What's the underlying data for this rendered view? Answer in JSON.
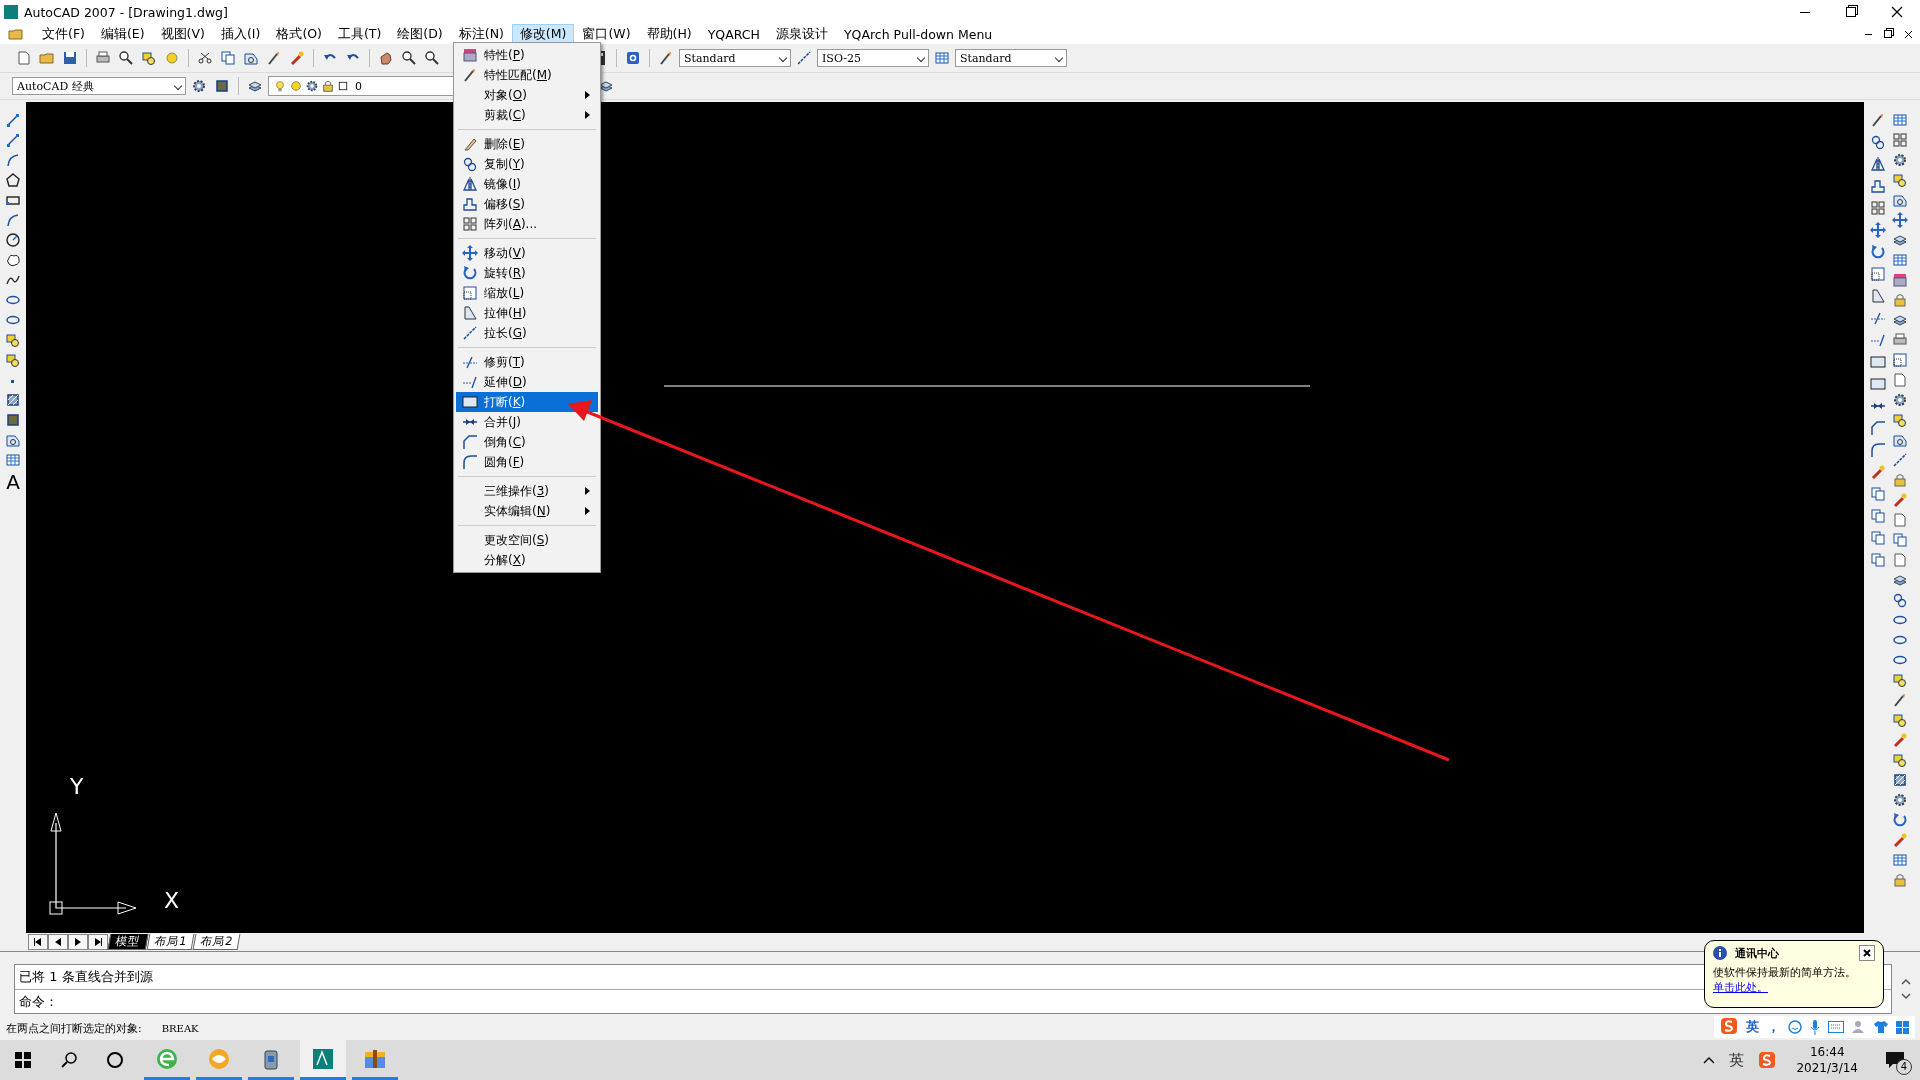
{
  "window": {
    "title": "AutoCAD 2007 - [Drawing1.dwg]"
  },
  "menu_bar": [
    {
      "label": "文件(F)",
      "selected": false
    },
    {
      "label": "编辑(E)",
      "selected": false
    },
    {
      "label": "视图(V)",
      "selected": false
    },
    {
      "label": "插入(I)",
      "selected": false
    },
    {
      "label": "格式(O)",
      "selected": false
    },
    {
      "label": "工具(T)",
      "selected": false
    },
    {
      "label": "绘图(D)",
      "selected": false
    },
    {
      "label": "标注(N)",
      "selected": false
    },
    {
      "label": "修改(M)",
      "selected": true
    },
    {
      "label": "窗口(W)",
      "selected": false
    },
    {
      "label": "帮助(H)",
      "selected": false
    },
    {
      "label": "YQARCH",
      "selected": false
    },
    {
      "label": "源泉设计",
      "selected": false
    },
    {
      "label": "YQArch Pull-down Menu",
      "selected": false
    }
  ],
  "toolbar": {
    "text_style": "Standard",
    "dim_style": "ISO-25",
    "table_style": "Standard",
    "workspace": "AutoCAD 经典",
    "layer": "0"
  },
  "draw_toolbar": {
    "text_tool": "A"
  },
  "modify_menu": {
    "groups": [
      [
        {
          "label": "特性(P)",
          "selected": false,
          "submenu": false
        },
        {
          "label": "特性匹配(M)",
          "selected": false,
          "submenu": false
        },
        {
          "label": "对象(O)",
          "selected": false,
          "submenu": true
        },
        {
          "label": "剪裁(C)",
          "selected": false,
          "submenu": true
        }
      ],
      [
        {
          "label": "删除(E)",
          "selected": false,
          "submenu": false
        },
        {
          "label": "复制(Y)",
          "selected": false,
          "submenu": false
        },
        {
          "label": "镜像(I)",
          "selected": false,
          "submenu": false
        },
        {
          "label": "偏移(S)",
          "selected": false,
          "submenu": false
        },
        {
          "label": "阵列(A)...",
          "selected": false,
          "submenu": false
        }
      ],
      [
        {
          "label": "移动(V)",
          "selected": false,
          "submenu": false
        },
        {
          "label": "旋转(R)",
          "selected": false,
          "submenu": false
        },
        {
          "label": "缩放(L)",
          "selected": false,
          "submenu": false
        },
        {
          "label": "拉伸(H)",
          "selected": false,
          "submenu": false
        },
        {
          "label": "拉长(G)",
          "selected": false,
          "submenu": false
        }
      ],
      [
        {
          "label": "修剪(T)",
          "selected": false,
          "submenu": false
        },
        {
          "label": "延伸(D)",
          "selected": false,
          "submenu": false
        },
        {
          "label": "打断(K)",
          "selected": true,
          "submenu": false
        },
        {
          "label": "合并(J)",
          "selected": false,
          "submenu": false
        },
        {
          "label": "倒角(C)",
          "selected": false,
          "submenu": false
        },
        {
          "label": "圆角(F)",
          "selected": false,
          "submenu": false
        }
      ],
      [
        {
          "label": "三维操作(3)",
          "selected": false,
          "submenu": true
        },
        {
          "label": "实体编辑(N)",
          "selected": false,
          "submenu": true
        }
      ],
      [
        {
          "label": "更改空间(S)",
          "selected": false,
          "submenu": false
        },
        {
          "label": "分解(X)",
          "selected": false,
          "submenu": false
        }
      ]
    ]
  },
  "canvas": {
    "axis_x": "X",
    "axis_y": "Y"
  },
  "layout_tabs": [
    {
      "label": "模型",
      "selected": true
    },
    {
      "label": "布局1",
      "selected": false
    },
    {
      "label": "布局2",
      "selected": false
    }
  ],
  "command_line": {
    "history": "已将 1 条直线合并到源",
    "prompt": "命令："
  },
  "status_bar": {
    "hint": "在两点之间打断选定的对象:",
    "command": "BREAK"
  },
  "notification": {
    "title": "通讯中心",
    "text": "使软件保持最新的简单方法。",
    "link": "单击此处。"
  },
  "ime_bar": {
    "language": "英",
    "punctuation": "，"
  },
  "taskbar": {
    "apps": [
      {
        "kind": "browser",
        "selected": false
      },
      {
        "kind": "mail",
        "selected": false
      },
      {
        "kind": "bin",
        "selected": false
      },
      {
        "kind": "cad",
        "selected": true
      },
      {
        "kind": "archive",
        "selected": false
      }
    ],
    "tray_language": "英",
    "time": "16:44",
    "date": "2021/3/14",
    "notification_count": "4"
  }
}
